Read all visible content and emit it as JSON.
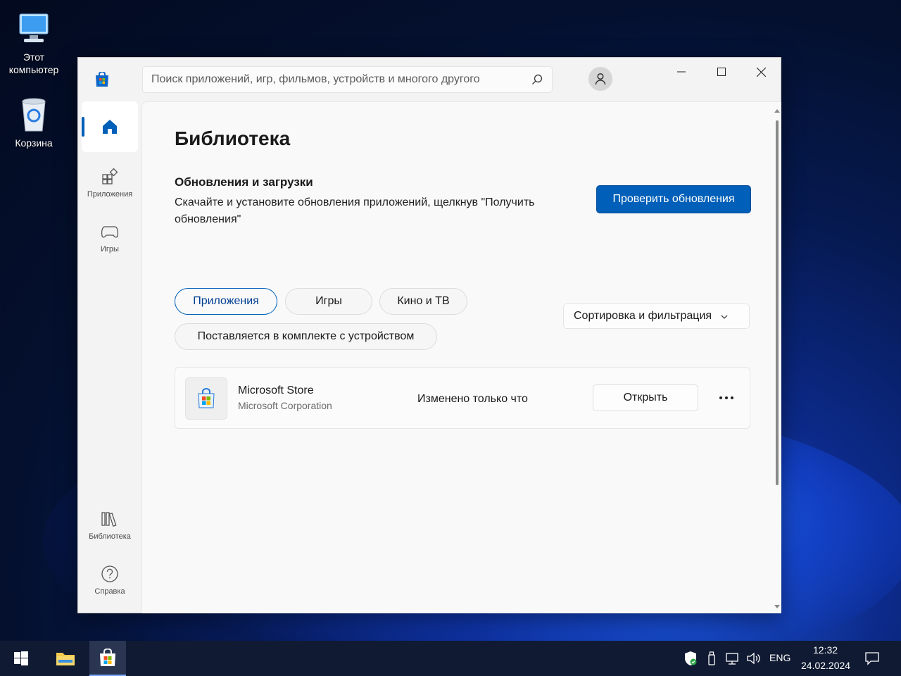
{
  "desktop": {
    "icons": [
      {
        "label": "Этот\nкомпьютер"
      },
      {
        "label": "Корзина"
      }
    ]
  },
  "window": {
    "search_placeholder": "Поиск приложений, игр, фильмов, устройств и многого другого",
    "controls": {
      "minimize": "minimize",
      "maximize": "maximize",
      "close": "close"
    }
  },
  "sidebar": {
    "items": [
      {
        "label": "",
        "icon": "home-icon"
      },
      {
        "label": "Приложения",
        "icon": "apps-icon"
      },
      {
        "label": "Игры",
        "icon": "gamepad-icon"
      },
      {
        "label": "Библиотека",
        "icon": "library-icon"
      },
      {
        "label": "Справка",
        "icon": "help-icon"
      }
    ]
  },
  "main": {
    "title": "Библиотека",
    "updates_title": "Обновления и загрузки",
    "updates_desc": "Скачайте и установите обновления приложений, щелкнув \"Получить обновления\"",
    "check_button": "Проверить обновления",
    "filters": [
      {
        "label": "Приложения",
        "selected": true
      },
      {
        "label": "Игры",
        "selected": false
      },
      {
        "label": "Кино и ТВ",
        "selected": false
      },
      {
        "label": "Поставляется в комплекте с устройством",
        "selected": false
      }
    ],
    "sort_label": "Сортировка и фильтрация",
    "apps": [
      {
        "name": "Microsoft Store",
        "publisher": "Microsoft Corporation",
        "status": "Изменено только что",
        "action": "Открыть"
      }
    ]
  },
  "taskbar": {
    "language": "ENG",
    "time": "12:32",
    "date": "24.02.2024"
  },
  "colors": {
    "accent": "#005fb8",
    "window_bg": "#f3f3f3",
    "taskbar_bg": "#101a33"
  }
}
